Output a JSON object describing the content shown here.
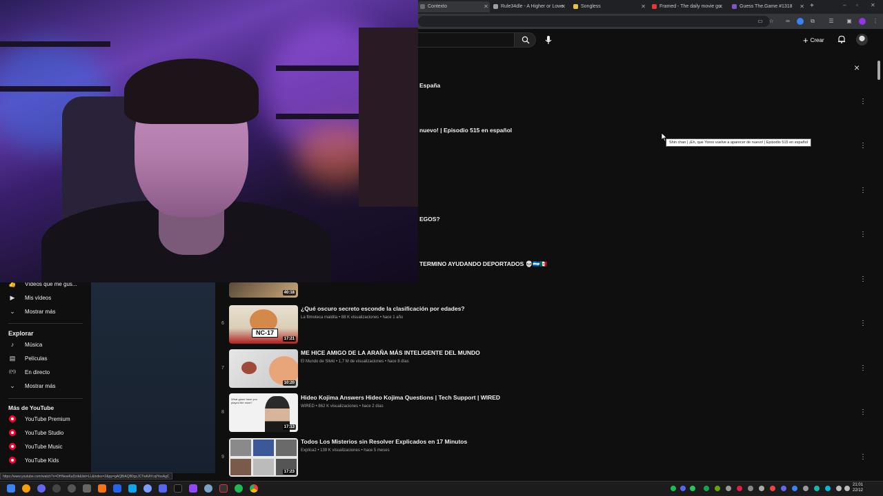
{
  "browser": {
    "tabs": [
      {
        "label": "Contexto",
        "color": "#6b6b6b"
      },
      {
        "label": "Rule34dle - A Higher or Lowe",
        "color": "#9aa0a6"
      },
      {
        "label": "Songless",
        "color": "#e8c14a"
      },
      {
        "label": "Framed - The daily movie gu",
        "color": "#e53935"
      },
      {
        "label": "Guess The.Game #1318",
        "color": "#7e57c2"
      }
    ],
    "new_tab": "+"
  },
  "topbar": {
    "create_label": "Crear",
    "close_symbol": "×"
  },
  "sidebar": {
    "top_items": [
      {
        "label": "Vídeos que me gus...",
        "icon": "thumbs-up-icon",
        "glyph": "👍"
      },
      {
        "label": "Mis vídeos",
        "icon": "play-square-icon",
        "glyph": "▶"
      },
      {
        "label": "Mostrar más",
        "icon": "chevron-down-icon",
        "glyph": "⌄"
      }
    ],
    "explore_heading": "Explorar",
    "explore_items": [
      {
        "label": "Música",
        "icon": "music-note-icon",
        "glyph": "♪"
      },
      {
        "label": "Películas",
        "icon": "film-icon",
        "glyph": "▤"
      },
      {
        "label": "En directo",
        "icon": "live-icon",
        "glyph": "((•))"
      },
      {
        "label": "Mostrar más",
        "icon": "chevron-down-icon",
        "glyph": "⌄"
      }
    ],
    "more_heading": "Más de YouTube",
    "more_items": [
      {
        "label": "YouTube Premium",
        "icon": "youtube-premium-icon"
      },
      {
        "label": "YouTube Studio",
        "icon": "youtube-studio-icon"
      },
      {
        "label": "YouTube Music",
        "icon": "youtube-music-icon"
      },
      {
        "label": "YouTube Kids",
        "icon": "youtube-kids-icon"
      }
    ]
  },
  "partial_titles": [
    "España",
    "nuevo! | Episodio 515 en español",
    "EGOS?",
    "TERMINO AYUDANDO DEPORTADOS 💀🇭🇳🇲🇽"
  ],
  "videos": [
    {
      "num": "",
      "title": "",
      "meta": "",
      "duration": "40:18"
    },
    {
      "num": "6",
      "title": "¿Qué oscuro secreto esconde la clasificación por edades?",
      "meta": "La filmoteca maldita • 88 K visualizaciones • hace 1 año",
      "duration": "17:21",
      "thumb_text": "NC-17"
    },
    {
      "num": "7",
      "title": "ME HICE AMIGO DE LA ARAÑA MÁS INTELIGENTE DEL MUNDO",
      "meta": "El Mundo de Slivki • 1,7 M de visualizaciones • hace 8 días",
      "duration": "10:20"
    },
    {
      "num": "8",
      "title": "Hideo Kojima Answers Hideo Kojima Questions | Tech Support | WIRED",
      "meta": "WIRED • 862 K visualizaciones • hace 2 días",
      "duration": "17:13",
      "thumb_text": "What game have you played the most?"
    },
    {
      "num": "9",
      "title": "Todos Los Misterios sin Resolver Explicados en 17 Minutos",
      "meta": "Explica2 • 139 K visualizaciones • hace 5 meses",
      "duration": "17:23"
    }
  ],
  "tooltip": "Shin chan | ¡Eh, que Yonro vuelve a aparecer de nuevo! | Episodio 515 en español",
  "status_url": "https://www.youtube.com/watch?v=DHNewKaDzik&list=LL&index=2&pp=gAQBiAQB0gcJCTwKAYcqlYosAgC",
  "taskbar": {
    "time": "21:01",
    "date": "22/12"
  }
}
